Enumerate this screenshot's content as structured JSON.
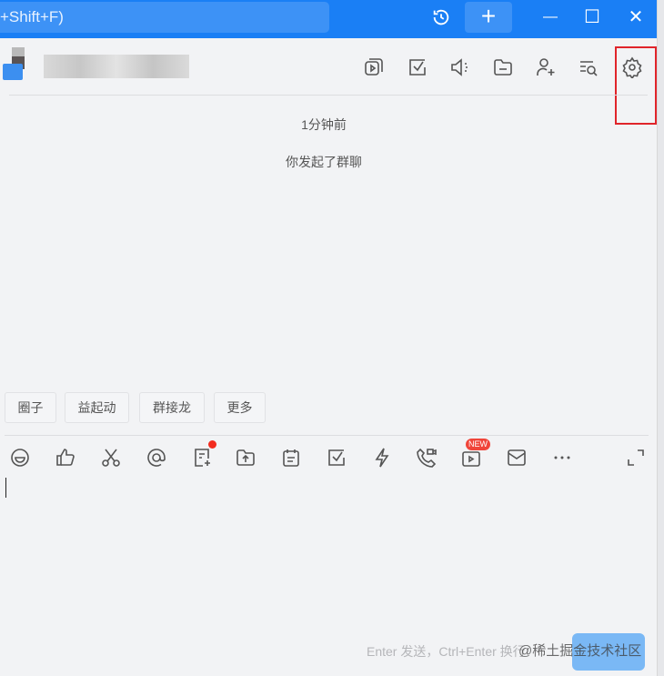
{
  "topbar": {
    "search_placeholder": "+Shift+F)",
    "add": "+",
    "minimize": "—",
    "maximize": "☐",
    "close": "✕"
  },
  "header": {
    "icons": [
      "screen-share-icon",
      "task-icon",
      "announcement-icon",
      "folder-icon",
      "add-member-icon",
      "search-history-icon",
      "settings-icon"
    ]
  },
  "messages": [
    {
      "text": "1分钟前"
    },
    {
      "text": "你发起了群聊"
    }
  ],
  "quick_actions": [
    {
      "label": "圈子"
    },
    {
      "label": "益起动"
    },
    {
      "label": "群接龙"
    },
    {
      "label": "更多"
    }
  ],
  "toolbar": {
    "new_badge": "NEW"
  },
  "composer": {
    "hint": "Enter 发送，Ctrl+Enter 换行",
    "watermark": "@稀土掘金技术社区"
  },
  "colors": {
    "accent": "#1a7ff5",
    "highlight": "#e0242a",
    "send": "#7ab8f5"
  }
}
